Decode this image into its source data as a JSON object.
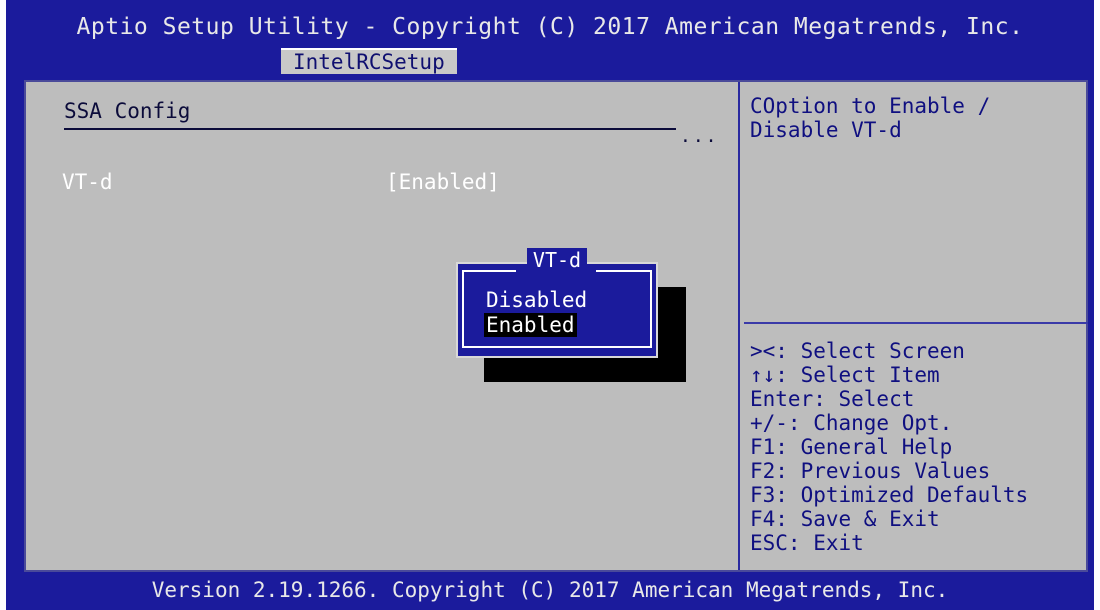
{
  "header": {
    "title": "Aptio Setup Utility - Copyright (C) 2017 American Megatrends, Inc.",
    "active_tab": "IntelRCSetup"
  },
  "main": {
    "section_title": "SSA Config",
    "ellipsis": "...",
    "setting": {
      "label": "VT-d",
      "value": "[Enabled]"
    }
  },
  "popup": {
    "title": "VT-d",
    "options": [
      "Disabled",
      "Enabled"
    ],
    "selected": "Enabled"
  },
  "help": {
    "text_line1": "COption to Enable /",
    "text_line2": "Disable VT-d"
  },
  "keys": [
    "><: Select Screen",
    "↑↓: Select Item",
    "Enter: Select",
    "+/-: Change Opt.",
    "F1: General Help",
    "F2: Previous Values",
    "F3: Optimized Defaults",
    "F4: Save & Exit",
    "ESC: Exit"
  ],
  "footer": {
    "version": "Version 2.19.1266. Copyright (C) 2017 American Megatrends, Inc."
  },
  "colors": {
    "bios_blue": "#1b1b9c",
    "panel_gray": "#bdbdbd",
    "help_blue": "#0f0f80"
  }
}
